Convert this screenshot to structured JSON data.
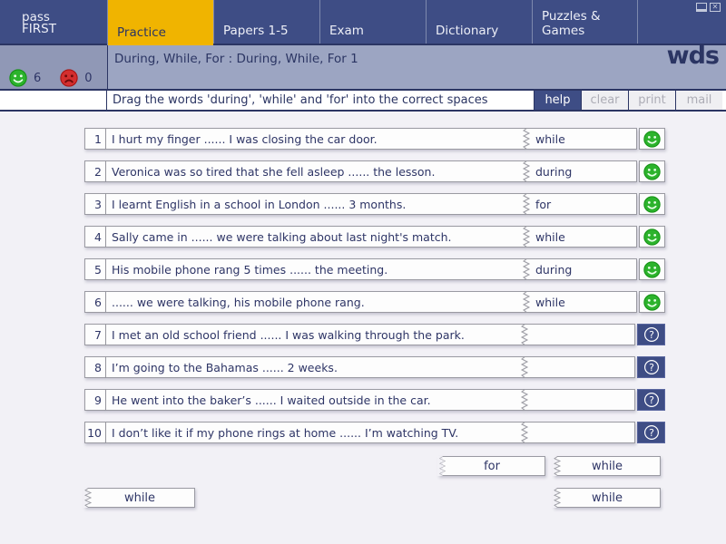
{
  "window": {
    "minimize_icon": "minimize",
    "close_icon": "close",
    "close_glyph": "✕"
  },
  "brand": {
    "line1": "pass",
    "line2": "FIRST",
    "logo": "wds"
  },
  "nav": {
    "tabs": [
      {
        "label": "Practice",
        "active": true
      },
      {
        "label": "Papers 1-5",
        "active": false
      },
      {
        "label": "Exam",
        "active": false
      },
      {
        "label": "Dictionary",
        "active": false
      },
      {
        "label": "Puzzles & Games",
        "active": false
      }
    ]
  },
  "score": {
    "correct": "6",
    "incorrect": "0"
  },
  "title": "During, While, For : During, While, For 1",
  "instruction": "Drag the words 'during', 'while' and 'for' into the correct spaces",
  "toolbar": {
    "help": "help",
    "clear": "clear",
    "print": "print",
    "mail": "mail"
  },
  "colors": {
    "nav_blue": "#3E4D85",
    "active_tab_yellow": "#F0B400",
    "band_gray": "#9CA5C2",
    "correct_green": "#2CB32C",
    "incorrect_red": "#D32F2F",
    "text_navy": "#2E3566"
  },
  "questions": [
    {
      "num": "1",
      "text": "I hurt my finger ...... I was closing the car door.",
      "answer": "while",
      "status": "correct"
    },
    {
      "num": "2",
      "text": "Veronica was so tired that she fell asleep ...... the lesson.",
      "answer": "during",
      "status": "correct"
    },
    {
      "num": "3",
      "text": "I learnt English in a school in London ...... 3 months.",
      "answer": "for",
      "status": "correct"
    },
    {
      "num": "4",
      "text": "Sally came in ...... we were talking about last night's match.",
      "answer": "while",
      "status": "correct"
    },
    {
      "num": "5",
      "text": "His mobile phone rang 5 times ...... the meeting.",
      "answer": "during",
      "status": "correct"
    },
    {
      "num": "6",
      "text": "...... we were talking, his mobile phone rang.",
      "answer": "while",
      "status": "correct"
    },
    {
      "num": "7",
      "text": "I met an old school friend ...... I was walking through the park.",
      "answer": "",
      "status": "unanswered"
    },
    {
      "num": "8",
      "text": "I’m going to the Bahamas ...... 2 weeks.",
      "answer": "",
      "status": "unanswered"
    },
    {
      "num": "9",
      "text": "He went into the baker’s ...... I waited outside in the car.",
      "answer": "",
      "status": "unanswered"
    },
    {
      "num": "10",
      "text": "I don’t like it if my phone rings at home ...... I’m watching TV.",
      "answer": "",
      "status": "unanswered"
    }
  ],
  "word_bank": [
    {
      "label": "for"
    },
    {
      "label": "while"
    },
    {
      "label": "while"
    },
    {
      "label": "while"
    }
  ]
}
